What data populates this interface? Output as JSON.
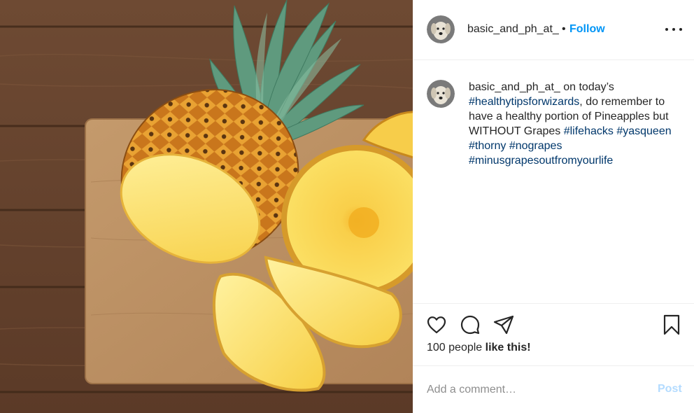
{
  "header": {
    "username": "basic_and_ph_at_",
    "separator": "•",
    "follow_label": "Follow",
    "more_icon": "more-horizontal-icon"
  },
  "caption": {
    "username": "basic_and_ph_at_",
    "segments": [
      {
        "text": " on today’s ",
        "type": "text"
      },
      {
        "text": "#healthytipsforwizards",
        "type": "tag"
      },
      {
        "text": ", do remember to have a healthy portion of Pineapples but WITHOUT Grapes ",
        "type": "text"
      },
      {
        "text": "#lifehacks",
        "type": "tag"
      },
      {
        "text": " ",
        "type": "text"
      },
      {
        "text": "#yasqueen",
        "type": "tag"
      },
      {
        "text": " ",
        "type": "text"
      },
      {
        "text": "#thorny",
        "type": "tag"
      },
      {
        "text": " ",
        "type": "text"
      },
      {
        "text": "#nograpes",
        "type": "tag"
      },
      {
        "text": " ",
        "type": "text"
      },
      {
        "text": "#minusgrapesoutfromyourlife",
        "type": "tag"
      }
    ]
  },
  "actions": {
    "icons": [
      "heart-icon",
      "comment-icon",
      "share-icon",
      "bookmark-icon"
    ]
  },
  "likes": {
    "count_text": "100 people",
    "suffix": "like this!"
  },
  "comment": {
    "placeholder": "Add a comment…",
    "post_label": "Post"
  },
  "colors": {
    "follow": "#0095f6",
    "hashtag": "#00376b",
    "post_disabled": "#b3dbff",
    "divider": "#efefef"
  },
  "photo": {
    "subject": "pineapple-photo"
  }
}
